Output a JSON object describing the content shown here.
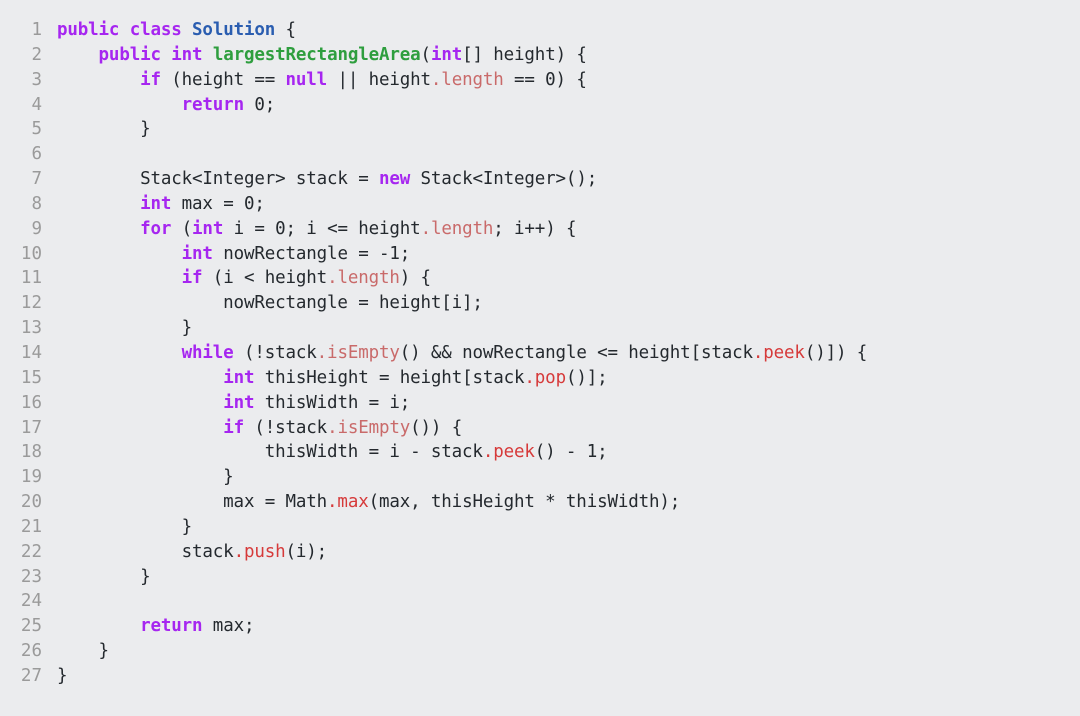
{
  "editor": {
    "language": "java",
    "background_color": "#ebecee",
    "default_text_color": "#24292e",
    "gutter_color": "#9a9a9a",
    "keyword_color": "#a626f0",
    "class_name_color": "#2a5db0",
    "method_declaration_color": "#2e9e3e",
    "member_access_color": "#c96a6a",
    "static_call_color": "#d63a3a",
    "total_lines": 27
  },
  "lines": [
    {
      "number": "1",
      "plain": "public class Solution {",
      "tokens": [
        {
          "t": "public",
          "c": "kw"
        },
        {
          "t": " ",
          "c": "plain"
        },
        {
          "t": "class",
          "c": "kw"
        },
        {
          "t": " ",
          "c": "plain"
        },
        {
          "t": "Solution",
          "c": "type"
        },
        {
          "t": " {",
          "c": "plain"
        }
      ]
    },
    {
      "number": "2",
      "plain": "    public int largestRectangleArea(int[] height) {",
      "tokens": [
        {
          "t": "    ",
          "c": "plain"
        },
        {
          "t": "public",
          "c": "kw"
        },
        {
          "t": " ",
          "c": "plain"
        },
        {
          "t": "int",
          "c": "kw"
        },
        {
          "t": " ",
          "c": "plain"
        },
        {
          "t": "largestRectangleArea",
          "c": "fn"
        },
        {
          "t": "(",
          "c": "plain"
        },
        {
          "t": "int",
          "c": "kw"
        },
        {
          "t": "[] height) {",
          "c": "plain"
        }
      ]
    },
    {
      "number": "3",
      "plain": "        if (height == null || height.length == 0) {",
      "tokens": [
        {
          "t": "        ",
          "c": "plain"
        },
        {
          "t": "if",
          "c": "kw"
        },
        {
          "t": " (height == ",
          "c": "plain"
        },
        {
          "t": "null",
          "c": "kw"
        },
        {
          "t": " || height",
          "c": "plain"
        },
        {
          "t": ".length",
          "c": "mem"
        },
        {
          "t": " == 0) {",
          "c": "plain"
        }
      ]
    },
    {
      "number": "4",
      "plain": "            return 0;",
      "tokens": [
        {
          "t": "            ",
          "c": "plain"
        },
        {
          "t": "return",
          "c": "kw"
        },
        {
          "t": " 0;",
          "c": "plain"
        }
      ]
    },
    {
      "number": "5",
      "plain": "        }",
      "tokens": [
        {
          "t": "        }",
          "c": "plain"
        }
      ]
    },
    {
      "number": "6",
      "plain": "",
      "tokens": []
    },
    {
      "number": "7",
      "plain": "        Stack<Integer> stack = new Stack<Integer>();",
      "tokens": [
        {
          "t": "        Stack<Integer> stack = ",
          "c": "plain"
        },
        {
          "t": "new",
          "c": "kw"
        },
        {
          "t": " Stack<Integer>();",
          "c": "plain"
        }
      ]
    },
    {
      "number": "8",
      "plain": "        int max = 0;",
      "tokens": [
        {
          "t": "        ",
          "c": "plain"
        },
        {
          "t": "int",
          "c": "kw"
        },
        {
          "t": " max = 0;",
          "c": "plain"
        }
      ]
    },
    {
      "number": "9",
      "plain": "        for (int i = 0; i <= height.length; i++) {",
      "tokens": [
        {
          "t": "        ",
          "c": "plain"
        },
        {
          "t": "for",
          "c": "kw"
        },
        {
          "t": " (",
          "c": "plain"
        },
        {
          "t": "int",
          "c": "kw"
        },
        {
          "t": " i = 0; i <= height",
          "c": "plain"
        },
        {
          "t": ".length",
          "c": "mem"
        },
        {
          "t": "; i++) {",
          "c": "plain"
        }
      ]
    },
    {
      "number": "10",
      "plain": "            int nowRectangle = -1;",
      "tokens": [
        {
          "t": "            ",
          "c": "plain"
        },
        {
          "t": "int",
          "c": "kw"
        },
        {
          "t": " nowRectangle = -1;",
          "c": "plain"
        }
      ]
    },
    {
      "number": "11",
      "plain": "            if (i < height.length) {",
      "tokens": [
        {
          "t": "            ",
          "c": "plain"
        },
        {
          "t": "if",
          "c": "kw"
        },
        {
          "t": " (i < height",
          "c": "plain"
        },
        {
          "t": ".length",
          "c": "mem"
        },
        {
          "t": ") {",
          "c": "plain"
        }
      ]
    },
    {
      "number": "12",
      "plain": "                nowRectangle = height[i];",
      "tokens": [
        {
          "t": "                nowRectangle = height[i];",
          "c": "plain"
        }
      ]
    },
    {
      "number": "13",
      "plain": "            }",
      "tokens": [
        {
          "t": "            }",
          "c": "plain"
        }
      ]
    },
    {
      "number": "14",
      "plain": "            while (!stack.isEmpty() && nowRectangle <= height[stack.peek()]) {",
      "tokens": [
        {
          "t": "            ",
          "c": "plain"
        },
        {
          "t": "while",
          "c": "kw"
        },
        {
          "t": " (!stack",
          "c": "plain"
        },
        {
          "t": ".isEmpty",
          "c": "mem"
        },
        {
          "t": "() && nowRectangle <= height[stack",
          "c": "plain"
        },
        {
          "t": ".peek",
          "c": "mem2"
        },
        {
          "t": "()]) {",
          "c": "plain"
        }
      ]
    },
    {
      "number": "15",
      "plain": "                int thisHeight = height[stack.pop()];",
      "tokens": [
        {
          "t": "                ",
          "c": "plain"
        },
        {
          "t": "int",
          "c": "kw"
        },
        {
          "t": " thisHeight = height[stack",
          "c": "plain"
        },
        {
          "t": ".pop",
          "c": "mem2"
        },
        {
          "t": "()];",
          "c": "plain"
        }
      ]
    },
    {
      "number": "16",
      "plain": "                int thisWidth = i;",
      "tokens": [
        {
          "t": "                ",
          "c": "plain"
        },
        {
          "t": "int",
          "c": "kw"
        },
        {
          "t": " thisWidth = i;",
          "c": "plain"
        }
      ]
    },
    {
      "number": "17",
      "plain": "                if (!stack.isEmpty()) {",
      "tokens": [
        {
          "t": "                ",
          "c": "plain"
        },
        {
          "t": "if",
          "c": "kw"
        },
        {
          "t": " (!stack",
          "c": "plain"
        },
        {
          "t": ".isEmpty",
          "c": "mem"
        },
        {
          "t": "()) {",
          "c": "plain"
        }
      ]
    },
    {
      "number": "18",
      "plain": "                    thisWidth = i - stack.peek() - 1;",
      "tokens": [
        {
          "t": "                    thisWidth = i - stack",
          "c": "plain"
        },
        {
          "t": ".peek",
          "c": "mem2"
        },
        {
          "t": "() - 1;",
          "c": "plain"
        }
      ]
    },
    {
      "number": "19",
      "plain": "                }",
      "tokens": [
        {
          "t": "                }",
          "c": "plain"
        }
      ]
    },
    {
      "number": "20",
      "plain": "                max = Math.max(max, thisHeight * thisWidth);",
      "tokens": [
        {
          "t": "                max = Math",
          "c": "plain"
        },
        {
          "t": ".max",
          "c": "mem2"
        },
        {
          "t": "(max, thisHeight * thisWidth);",
          "c": "plain"
        }
      ]
    },
    {
      "number": "21",
      "plain": "            }",
      "tokens": [
        {
          "t": "            }",
          "c": "plain"
        }
      ]
    },
    {
      "number": "22",
      "plain": "            stack.push(i);",
      "tokens": [
        {
          "t": "            stack",
          "c": "plain"
        },
        {
          "t": ".push",
          "c": "mem2"
        },
        {
          "t": "(i);",
          "c": "plain"
        }
      ]
    },
    {
      "number": "23",
      "plain": "        }",
      "tokens": [
        {
          "t": "        }",
          "c": "plain"
        }
      ]
    },
    {
      "number": "24",
      "plain": "",
      "tokens": []
    },
    {
      "number": "25",
      "plain": "        return max;",
      "tokens": [
        {
          "t": "        ",
          "c": "plain"
        },
        {
          "t": "return",
          "c": "kw"
        },
        {
          "t": " max;",
          "c": "plain"
        }
      ]
    },
    {
      "number": "26",
      "plain": "    }",
      "tokens": [
        {
          "t": "    }",
          "c": "plain"
        }
      ]
    },
    {
      "number": "27",
      "plain": "}",
      "tokens": [
        {
          "t": "}",
          "c": "plain"
        }
      ]
    }
  ]
}
